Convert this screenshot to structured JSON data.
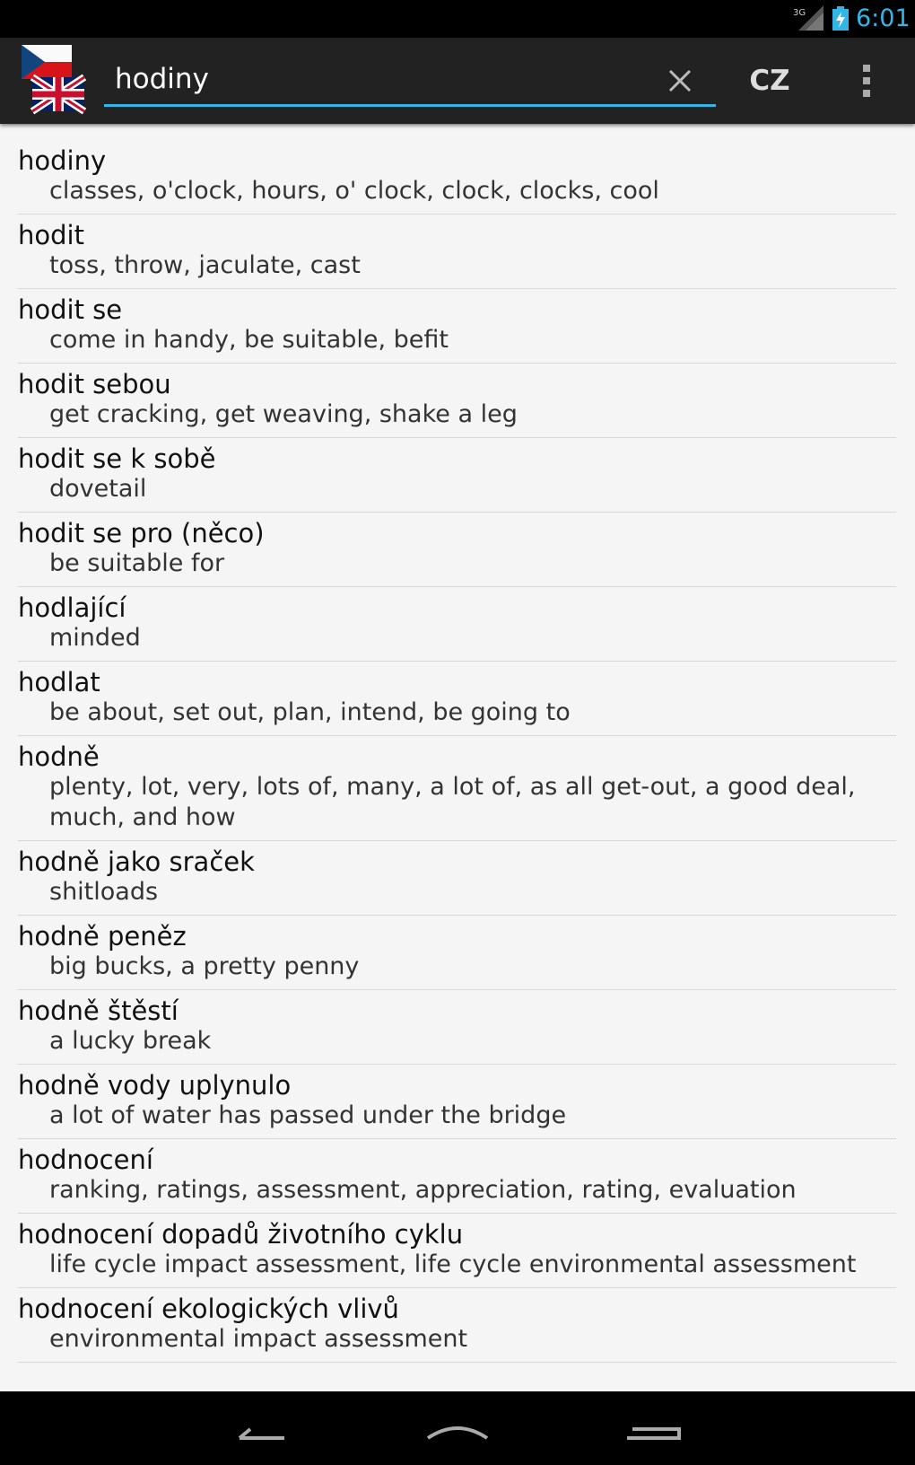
{
  "status_bar": {
    "network": "3G",
    "time": "6:01"
  },
  "action_bar": {
    "search": {
      "value": "hodiny",
      "placeholder": ""
    },
    "language_toggle": "CZ"
  },
  "results": [
    {
      "term": "hodiny",
      "translation": "classes, o'clock, hours, o' clock, clock, clocks, cool"
    },
    {
      "term": "hodit",
      "translation": "toss, throw, jaculate, cast"
    },
    {
      "term": "hodit se",
      "translation": "come in handy, be suitable, befit"
    },
    {
      "term": "hodit sebou",
      "translation": "get cracking, get weaving, shake a leg"
    },
    {
      "term": "hodit se k sobě",
      "translation": "dovetail"
    },
    {
      "term": "hodit se pro (něco)",
      "translation": "be suitable for"
    },
    {
      "term": "hodlající",
      "translation": "minded"
    },
    {
      "term": "hodlat",
      "translation": "be about, set out, plan, intend, be going to"
    },
    {
      "term": "hodně",
      "translation": "plenty, lot, very, lots of, many, a lot of, as all get-out, a good deal, much, and how"
    },
    {
      "term": "hodně jako sraček",
      "translation": "shitloads"
    },
    {
      "term": "hodně peněz",
      "translation": "big bucks, a pretty penny"
    },
    {
      "term": "hodně štěstí",
      "translation": "a lucky break"
    },
    {
      "term": "hodně vody uplynulo",
      "translation": "a lot of water has passed under the bridge"
    },
    {
      "term": "hodnocení",
      "translation": "ranking, ratings, assessment, appreciation, rating, evaluation"
    },
    {
      "term": "hodnocení dopadů životního cyklu",
      "translation": "life cycle impact assessment, life cycle environmental assessment"
    },
    {
      "term": "hodnocení ekologických vlivů",
      "translation": "environmental impact assessment"
    }
  ],
  "colors": {
    "accent": "#33b5e5",
    "action_bar": "#222222",
    "list_background": "#f5f5f5"
  }
}
